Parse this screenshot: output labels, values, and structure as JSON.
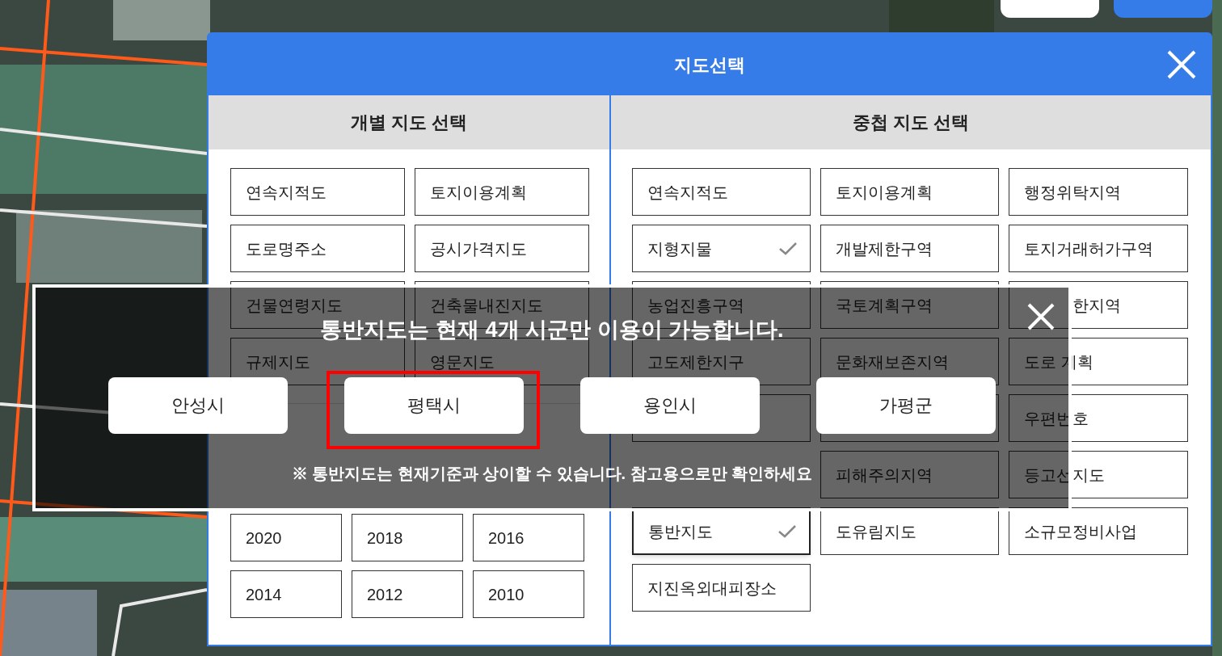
{
  "dialog": {
    "title": "지도선택"
  },
  "single_maps": {
    "heading": "개별 지도 선택",
    "items": [
      {
        "label": "연속지적도",
        "checked": false
      },
      {
        "label": "토지이용계획",
        "checked": false
      },
      {
        "label": "도로명주소",
        "checked": false
      },
      {
        "label": "공시가격지도",
        "checked": false
      },
      {
        "label": "건물연령지도",
        "checked": false
      },
      {
        "label": "건축물내진지도",
        "checked": false
      },
      {
        "label": "규제지도",
        "checked": false
      },
      {
        "label": "영문지도",
        "checked": false
      }
    ],
    "aerial": {
      "years": [
        {
          "label": "2020",
          "checked": false
        },
        {
          "label": "2018",
          "checked": false
        },
        {
          "label": "2016",
          "checked": false
        },
        {
          "label": "2014",
          "checked": false
        },
        {
          "label": "2012",
          "checked": false
        },
        {
          "label": "2010",
          "checked": false
        }
      ]
    }
  },
  "overlay_maps": {
    "heading": "중첩 지도 선택",
    "items": [
      {
        "label": "연속지적도",
        "checked": false,
        "selected": false
      },
      {
        "label": "토지이용계획",
        "checked": false,
        "selected": false
      },
      {
        "label": "행정위탁지역",
        "checked": false,
        "selected": false
      },
      {
        "label": "지형지물",
        "checked": true,
        "selected": false
      },
      {
        "label": "개발제한구역",
        "checked": false,
        "selected": false
      },
      {
        "label": "토지거래허가구역",
        "checked": false,
        "selected": false
      },
      {
        "label": "농업진흥구역",
        "checked": false,
        "selected": false
      },
      {
        "label": "국토계획구역",
        "checked": false,
        "selected": false
      },
      {
        "kind": "cut",
        "label": "한지역",
        "checked": false,
        "selected": false
      },
      {
        "label": "고도제한지구",
        "checked": false,
        "selected": false
      },
      {
        "label": "문화재보존지역",
        "checked": false,
        "selected": false
      },
      {
        "label": "도로 계획",
        "checked": false,
        "selected": false
      },
      {
        "kind": "blank"
      },
      {
        "kind": "blank"
      },
      {
        "label": "우편번호",
        "checked": false,
        "selected": false
      },
      {
        "kind": "gap"
      },
      {
        "label": "피해주의지역",
        "checked": false,
        "selected": false
      },
      {
        "label": "등고선지도",
        "checked": false,
        "selected": false
      },
      {
        "label": "통반지도",
        "checked": true,
        "selected": true
      },
      {
        "label": "도유림지도",
        "checked": false,
        "selected": false
      },
      {
        "label": "소규모정비사업",
        "checked": false,
        "selected": false
      },
      {
        "label": "지진옥외대피장소",
        "checked": false,
        "selected": false
      }
    ]
  },
  "notice": {
    "message": "통반지도는 현재 4개 시군만 이용이 가능합니다.",
    "cities": [
      {
        "label": "안성시",
        "highlighted": false
      },
      {
        "label": "평택시",
        "highlighted": true
      },
      {
        "label": "용인시",
        "highlighted": false
      },
      {
        "label": "가평군",
        "highlighted": false
      }
    ],
    "note": "※ 통반지도는 현재기준과 상이할 수 있습니다. 참고용으로만 확인하세요"
  }
}
